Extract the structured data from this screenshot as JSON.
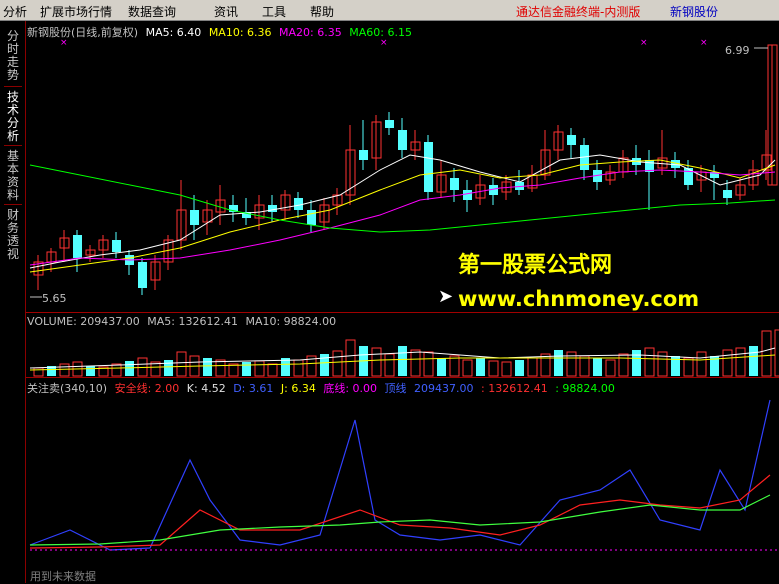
{
  "menu": {
    "items": [
      "分析",
      "扩展市场行情",
      "数据查询",
      "资讯",
      "工具",
      "帮助"
    ],
    "app_title": "通达信金融终端-内测版",
    "stock_name": "新钢股份"
  },
  "left_tabs": [
    "分时走势",
    "技术分析",
    "基本资料",
    "财务透视"
  ],
  "price_panel": {
    "title": "新钢股份(日线,前复权)",
    "ma5_label": "MA5: 6.40",
    "ma10_label": "MA10: 6.36",
    "ma20_label": "MA20: 6.35",
    "ma60_label": "MA60: 6.15",
    "high_marker": "6.99",
    "low_marker": "5.65",
    "colors": {
      "up": "#ff3232",
      "down": "#54ffff",
      "ma5": "#ffffff",
      "ma10": "#ffff00",
      "ma20": "#ff00ff",
      "ma60": "#00ff00"
    }
  },
  "volume_panel": {
    "vol_label": "VOLUME: 209437.00",
    "ma5_label": "MA5: 132612.41",
    "ma10_label": "MA10: 98824.00"
  },
  "indicator_panel": {
    "name": "关注卖(340,10)",
    "safe_label": "安全线: 2.00",
    "k_label": "K: 4.52",
    "d_label": "D: 3.61",
    "j_label": "J: 6.34",
    "bottom_label": "底线: 0.00",
    "top_label": "顶线",
    "val1": "209437.00",
    "val2": ": 132612.41",
    "val3": ": 98824.00",
    "footer": "用到未来数据"
  },
  "watermark": {
    "line1": "第一股票公式网",
    "line2": "www.chnmoney.com"
  }
}
